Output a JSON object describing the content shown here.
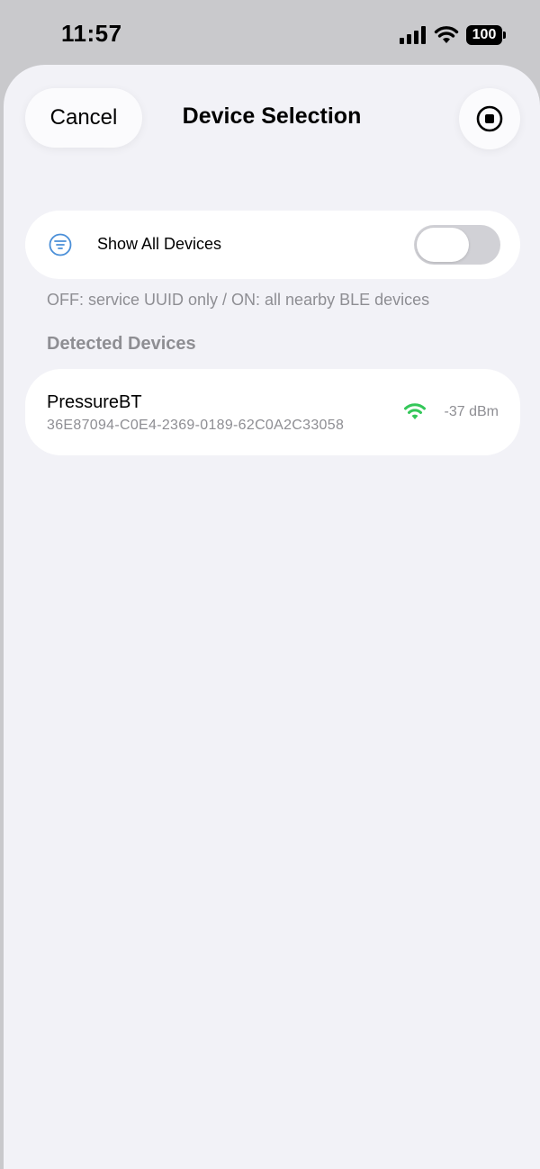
{
  "status_bar": {
    "time": "11:57",
    "battery": "100",
    "icons": [
      "signal-bars-icon",
      "wifi-icon",
      "battery-icon"
    ]
  },
  "header": {
    "cancel_label": "Cancel",
    "title": "Device Selection",
    "stop_icon": "stop-circle-icon"
  },
  "filter": {
    "label": "Show All Devices",
    "icon": "filter-lines-icon",
    "enabled": false,
    "footnote": "OFF: service UUID only / ON: all nearby BLE devices"
  },
  "devices_section": {
    "title": "Detected Devices",
    "devices": [
      {
        "name": "PressureBT",
        "uuid": "36E87094-C0E4-2369-0189-62C0A2C33058",
        "rssi": "-37 dBm",
        "signal_icon": "wifi-signal-icon"
      }
    ]
  },
  "colors": {
    "background": "#f2f2f7",
    "accent_blue": "#4a8fd8",
    "signal_green": "#34c759",
    "secondary_text": "#8e8e93",
    "toggle_off": "#d1d1d6"
  }
}
